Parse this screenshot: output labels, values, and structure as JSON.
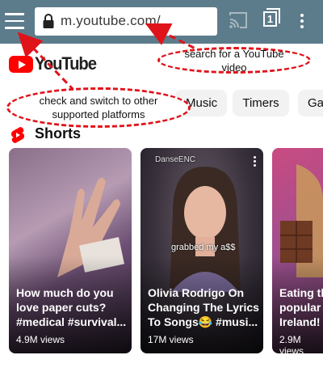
{
  "browser": {
    "url": "m.youtube.com/",
    "tab_count": "1",
    "icons": [
      "hamburger-menu-icon",
      "lock-icon",
      "cast-icon",
      "tabs-icon",
      "overflow-menu-icon"
    ]
  },
  "youtube": {
    "wordmark": "YouTube",
    "chips": [
      "Music",
      "Timers",
      "Ga"
    ],
    "shorts_label": "Shorts",
    "cards": [
      {
        "title": "How much do you\nlove paper cuts?\n#medical #survival...",
        "views": "4.9M views",
        "caption": ""
      },
      {
        "title": "Olivia Rodrigo On\nChanging The Lyrics\nTo Songs😂 #musi...",
        "views": "17M views",
        "caption": "grabbed my a$$",
        "watermark": "DanseENC"
      },
      {
        "title": "Eating th\npopular\nIreland!",
        "views": "2.9M views",
        "caption": ""
      }
    ]
  },
  "annotations": {
    "search": "search for a YouTube video",
    "platforms": "check and switch to other supported platforms"
  },
  "colors": {
    "browser_bar": "#5c7c8c",
    "youtube_red": "#ff0000",
    "annotation_red": "#e0131a",
    "chip_bg": "#f2f2f2"
  }
}
